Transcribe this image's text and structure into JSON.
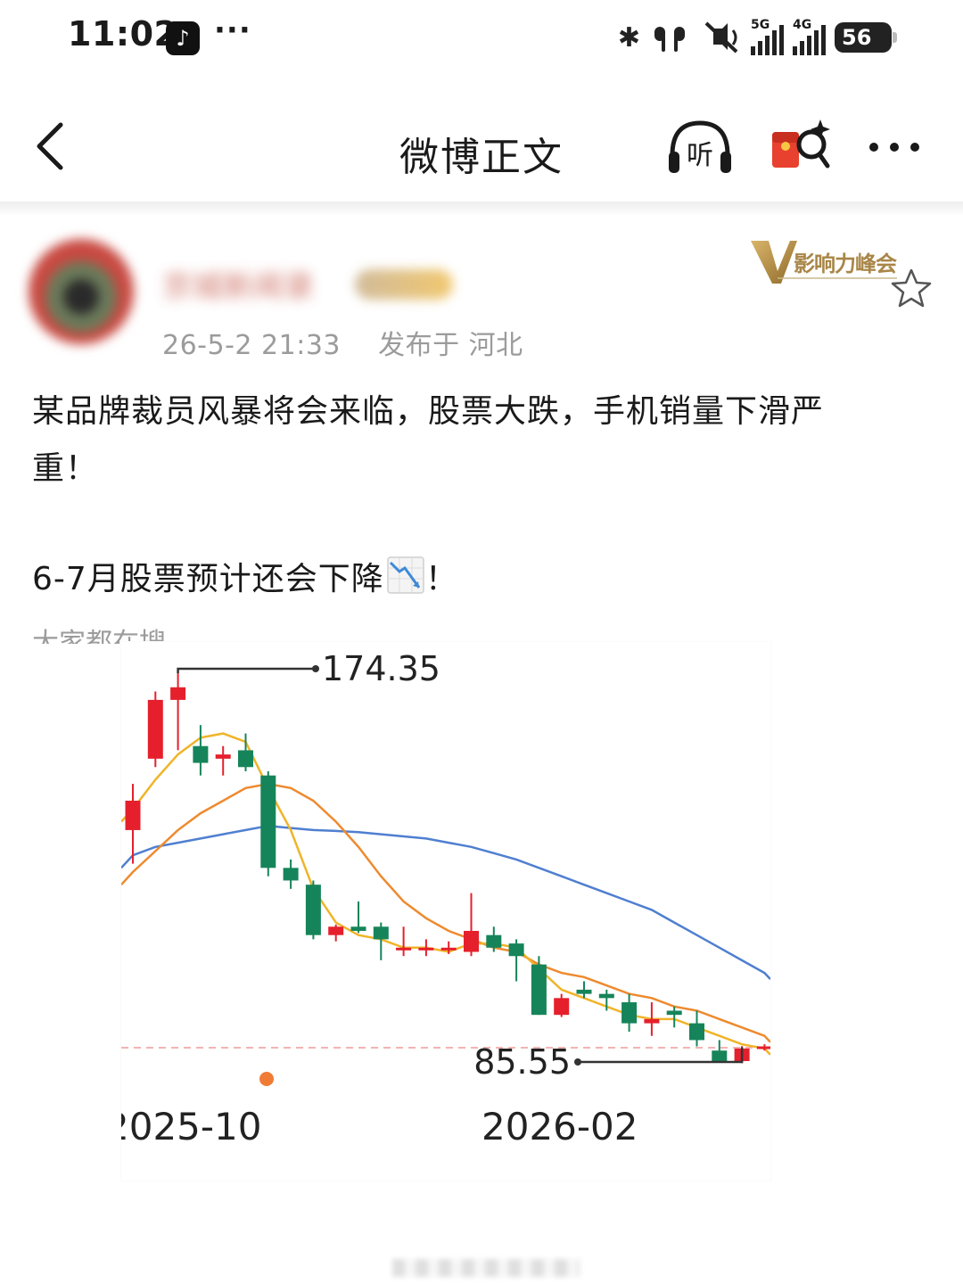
{
  "status_bar": {
    "time": "11:02",
    "more": "···",
    "net1": "5G",
    "net2": "4G",
    "battery": "56"
  },
  "header": {
    "title": "微博正文",
    "listen_label": "听"
  },
  "post": {
    "username": "京城新闻录",
    "time": "26-5-2 21:33",
    "location": "发布于 河北",
    "influence_badge": "影响力峰会",
    "line1": "某品牌裁员风暴将会来临，股票大跌，手机销量下滑严",
    "line2": "重！",
    "line3": "6-7月股票预计还会下降",
    "line3_end": "！",
    "cut_text": "大家都在搜"
  },
  "chart_data": {
    "type": "candlestick",
    "annotations": {
      "high": "174.35",
      "low": "85.55"
    },
    "x_tick_labels": [
      "2025-10",
      "2026-02"
    ],
    "colors": {
      "up": "#e5202c",
      "down": "#16845a",
      "ma_short": "#f0b429",
      "ma_mid": "#ee8a2e",
      "ma_long": "#4f7fd0"
    },
    "candles": [
      {
        "o": 137,
        "h": 148,
        "l": 129,
        "c": 144
      },
      {
        "o": 154,
        "h": 170,
        "l": 152,
        "c": 168
      },
      {
        "o": 168,
        "h": 174.35,
        "l": 156,
        "c": 171
      },
      {
        "o": 157,
        "h": 162,
        "l": 150,
        "c": 153
      },
      {
        "o": 154,
        "h": 157,
        "l": 150,
        "c": 155
      },
      {
        "o": 156,
        "h": 160,
        "l": 151,
        "c": 152
      },
      {
        "o": 150,
        "h": 151,
        "l": 126,
        "c": 128
      },
      {
        "o": 128,
        "h": 130,
        "l": 123,
        "c": 125
      },
      {
        "o": 124,
        "h": 125,
        "l": 111,
        "c": 112
      },
      {
        "o": 112,
        "h": 114.5,
        "l": 110.5,
        "c": 114
      },
      {
        "o": 114,
        "h": 120,
        "l": 112.5,
        "c": 113
      },
      {
        "o": 114,
        "h": 115,
        "l": 106,
        "c": 111
      },
      {
        "o": 109,
        "h": 114,
        "l": 107,
        "c": 109
      },
      {
        "o": 109,
        "h": 111,
        "l": 107,
        "c": 109
      },
      {
        "o": 109,
        "h": 110.5,
        "l": 107.5,
        "c": 109
      },
      {
        "o": 108,
        "h": 122,
        "l": 107,
        "c": 113
      },
      {
        "o": 112,
        "h": 114,
        "l": 108,
        "c": 109
      },
      {
        "o": 110,
        "h": 111,
        "l": 101,
        "c": 107
      },
      {
        "o": 105,
        "h": 107,
        "l": 93,
        "c": 93
      },
      {
        "o": 93,
        "h": 98,
        "l": 92.5,
        "c": 97
      },
      {
        "o": 99,
        "h": 101,
        "l": 97,
        "c": 98
      },
      {
        "o": 98,
        "h": 99,
        "l": 94,
        "c": 97
      },
      {
        "o": 96,
        "h": 98,
        "l": 89,
        "c": 91
      },
      {
        "o": 91,
        "h": 96,
        "l": 88,
        "c": 92
      },
      {
        "o": 94,
        "h": 95,
        "l": 90,
        "c": 93
      },
      {
        "o": 91,
        "h": 94,
        "l": 85.5,
        "c": 87
      },
      {
        "o": 84.5,
        "h": 87,
        "l": 82,
        "c": 82
      },
      {
        "o": 82,
        "h": 85.55,
        "l": 81.5,
        "c": 85
      },
      {
        "o": 85,
        "h": 86,
        "l": 84.5,
        "c": 85.5
      }
    ],
    "ma_short": [
      142,
      149,
      155,
      159,
      160,
      158,
      147,
      137,
      123,
      115,
      112,
      111,
      109,
      109,
      108,
      110,
      110,
      109,
      104,
      99,
      97,
      95,
      93,
      92,
      92,
      90,
      88,
      86,
      85
    ],
    "ma_mid": [
      127,
      132,
      137,
      141,
      144,
      147,
      148,
      147,
      144,
      139,
      133,
      126,
      120,
      116,
      113,
      111,
      109,
      108,
      105,
      103,
      102,
      100,
      98,
      97,
      95,
      94,
      92,
      90,
      88
    ],
    "ma_long": [
      131,
      133,
      134,
      135,
      136,
      137,
      138,
      137.5,
      137,
      136.8,
      136.5,
      136,
      135.5,
      135,
      134,
      133,
      131.5,
      130,
      128,
      126,
      124,
      122,
      120,
      118,
      115,
      112,
      109,
      106,
      103
    ]
  }
}
